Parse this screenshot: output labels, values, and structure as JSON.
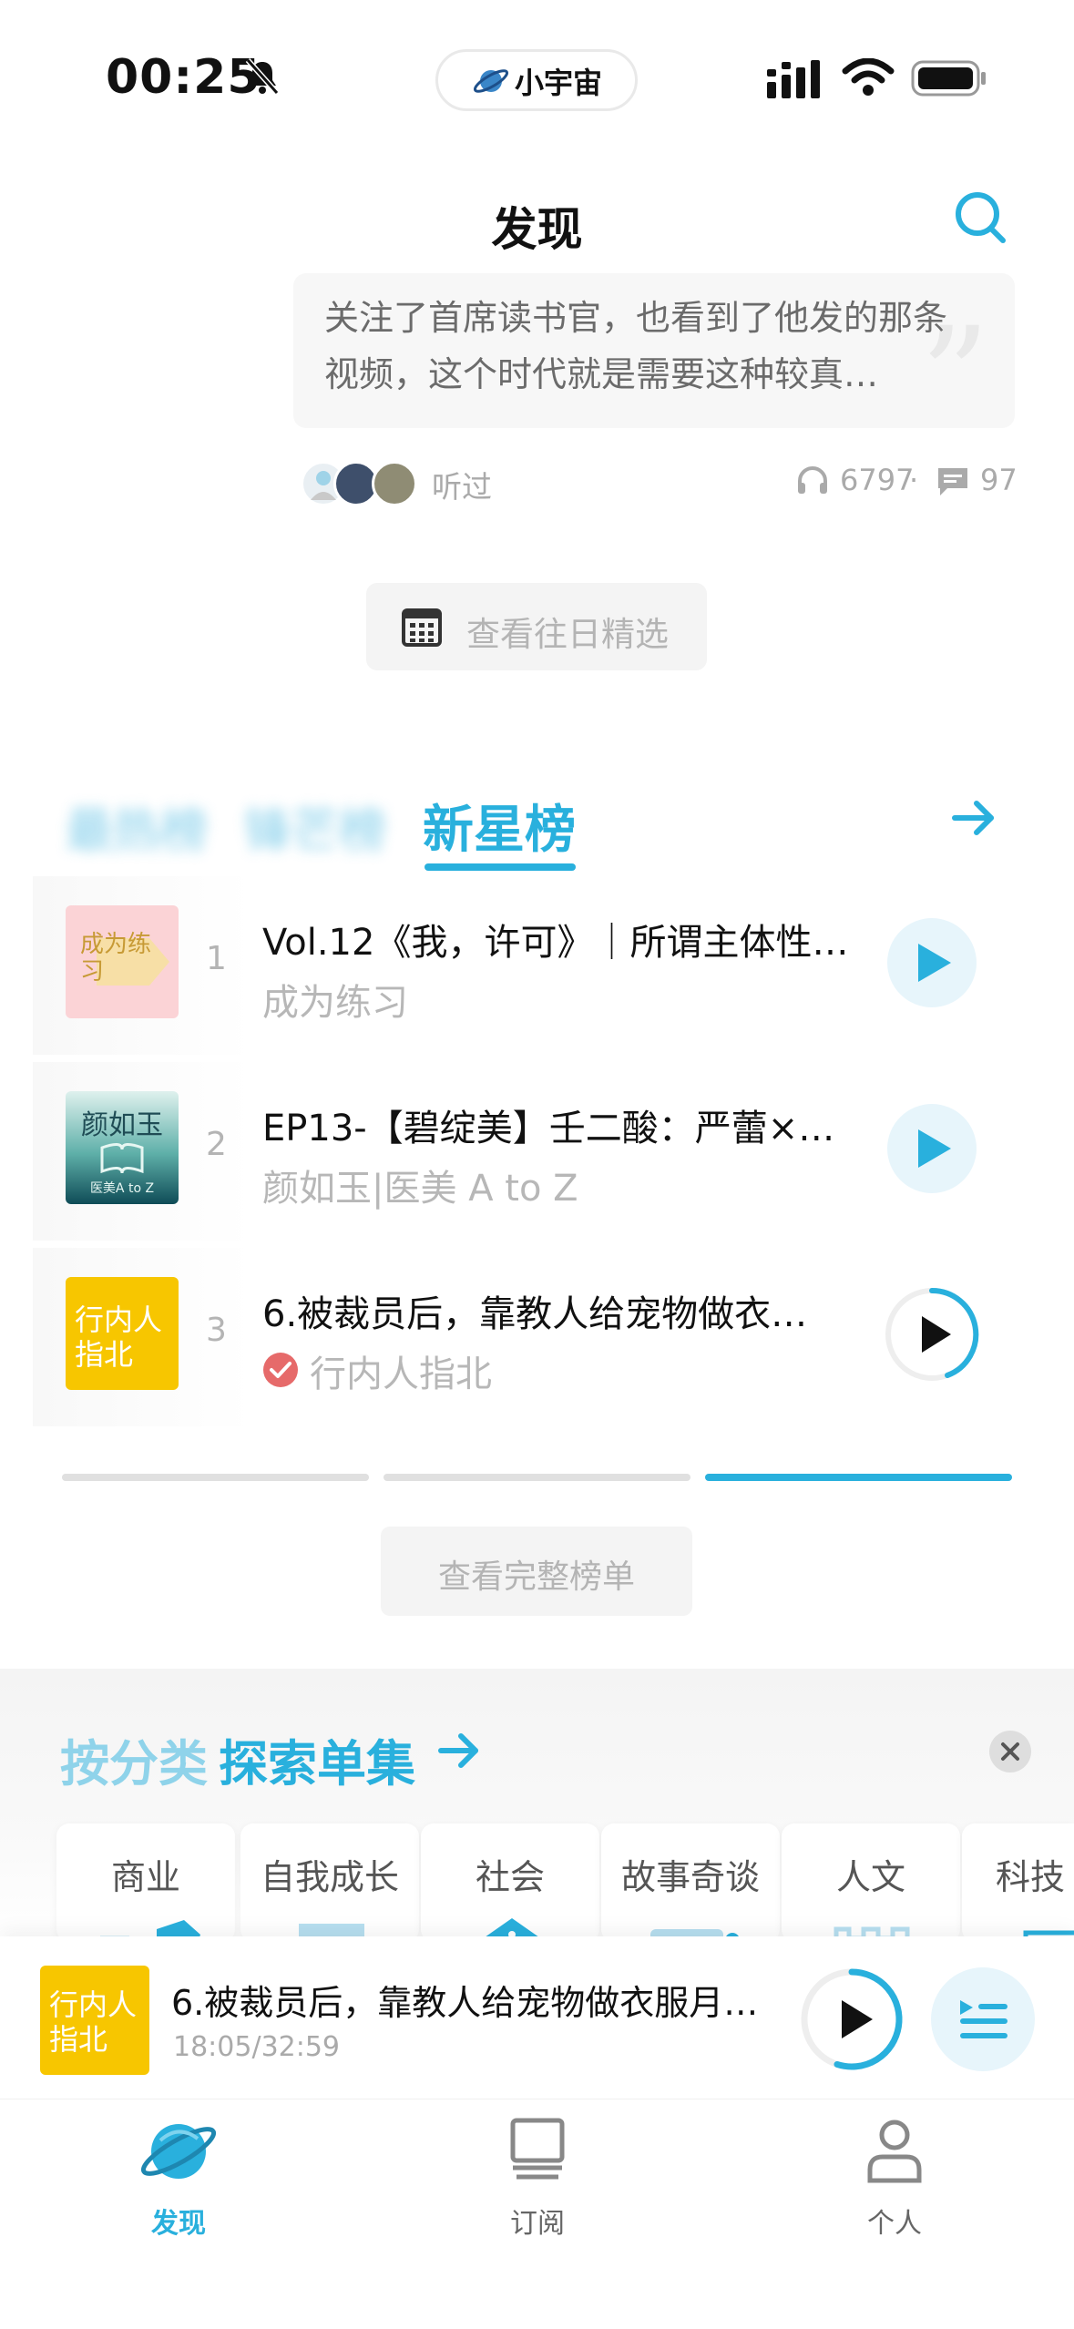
{
  "status_bar": {
    "time": "00:25",
    "app_pill_text": "小宇宙"
  },
  "header": {
    "title": "发现"
  },
  "comment": {
    "text": "关注了首席读书官，也看到了他发的那条视频，这个时代就是需要这种较真…",
    "listened_label": "听过",
    "plays": "6797",
    "separator": "·",
    "comments": "97"
  },
  "past_picks": {
    "label": "查看往日精选"
  },
  "ranking": {
    "tabs": [
      "最热榜",
      "锋芒榜",
      "新星榜"
    ],
    "active_tab": "新星榜",
    "items": [
      {
        "rank": "1",
        "title": "Vol.12《我，许可》｜所谓主体性…",
        "podcast": "成为练习",
        "cover_text": "成为练习",
        "cover_color": "#fbd3d6",
        "verified": false
      },
      {
        "rank": "2",
        "title": "EP13-【碧绽美】壬二酸：严蕾×…",
        "podcast": "颜如玉|医美 A to Z",
        "cover_text": "颜如玉",
        "cover_subtext": "医美A to Z",
        "cover_color": "#2a8a8c",
        "verified": false
      },
      {
        "rank": "3",
        "title": "6.被裁员后，靠教人给宠物做衣…",
        "podcast": "行内人指北",
        "cover_text": "行内人指北",
        "cover_color": "#f7c600",
        "verified": true
      }
    ],
    "full_list_label": "查看完整榜单",
    "page_count": 3,
    "active_page": 3
  },
  "explore": {
    "title_part1": "按分类",
    "title_part2": "探索单集",
    "categories": [
      "商业",
      "自我成长",
      "社会",
      "故事奇谈",
      "人文",
      "科技"
    ]
  },
  "mini_player": {
    "title": "6.被裁员后，靠教人给宠物做衣服月…",
    "time": "18:05/32:59",
    "cover_text": "行内人指北",
    "progress": 0.55
  },
  "tab_bar": {
    "items": [
      {
        "label": "发现",
        "icon": "planet-icon",
        "active": true
      },
      {
        "label": "订阅",
        "icon": "monitor-icon",
        "active": false
      },
      {
        "label": "个人",
        "icon": "person-icon",
        "active": false
      }
    ]
  },
  "colors": {
    "accent": "#29b0dd",
    "muted_text": "#b4b4b4",
    "verified": "#e66a6a"
  }
}
